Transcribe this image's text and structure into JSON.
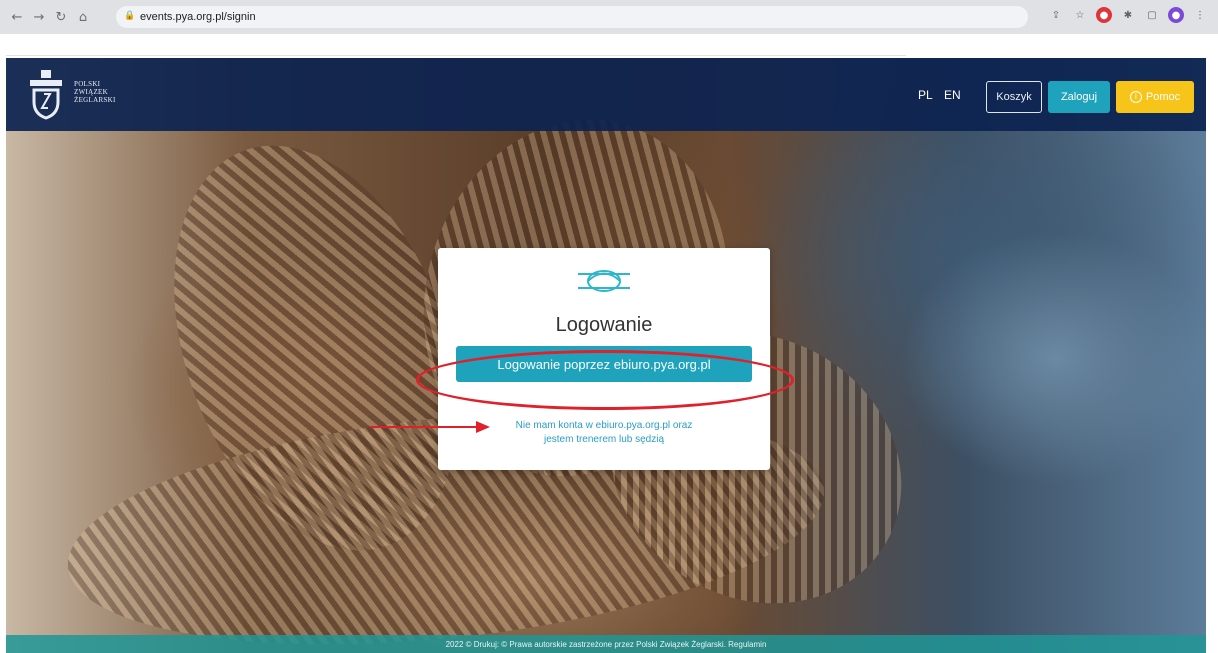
{
  "browser": {
    "url": "events.pya.org.pl/signin"
  },
  "header": {
    "logo_text_lines": [
      "POLSKI",
      "ZWIĄZEK",
      "ŻEGLARSKI"
    ],
    "lang_pl": "PL",
    "lang_en": "EN",
    "cart_label": "Koszyk",
    "login_label": "Zaloguj",
    "help_label": "Pomoc"
  },
  "login_card": {
    "title": "Logowanie",
    "ebiuro_button": "Logowanie poprzez ebiuro.pya.org.pl",
    "no_account_link_line1": "Nie mam konta w ebiuro.pya.org.pl oraz",
    "no_account_link_line2": "jestem trenerem lub sędzią"
  },
  "footer": {
    "text": "2022 © Drukuj: © Prawa autorskie zastrzeżone przez Polski Związek Żeglarski. Regulamin"
  },
  "colors": {
    "nav_bg": "#0c2350",
    "accent_teal": "#1fa3bd",
    "help_yellow": "#f7c41a",
    "annotation_red": "#e0202a"
  }
}
